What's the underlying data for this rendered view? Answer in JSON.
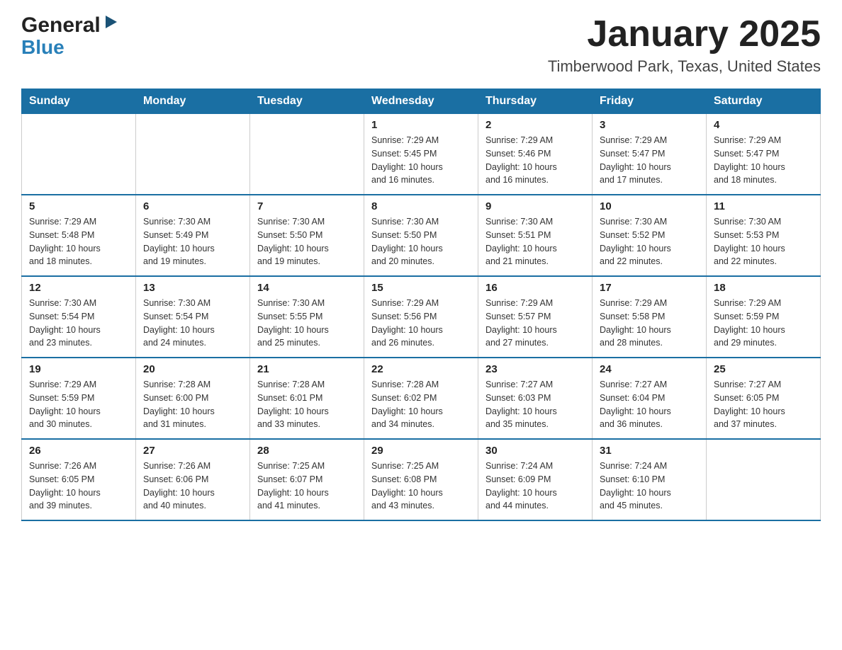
{
  "header": {
    "logo_general": "General",
    "logo_blue": "Blue",
    "month_title": "January 2025",
    "location": "Timberwood Park, Texas, United States"
  },
  "weekdays": [
    "Sunday",
    "Monday",
    "Tuesday",
    "Wednesday",
    "Thursday",
    "Friday",
    "Saturday"
  ],
  "weeks": [
    [
      {
        "day": "",
        "info": ""
      },
      {
        "day": "",
        "info": ""
      },
      {
        "day": "",
        "info": ""
      },
      {
        "day": "1",
        "info": "Sunrise: 7:29 AM\nSunset: 5:45 PM\nDaylight: 10 hours\nand 16 minutes."
      },
      {
        "day": "2",
        "info": "Sunrise: 7:29 AM\nSunset: 5:46 PM\nDaylight: 10 hours\nand 16 minutes."
      },
      {
        "day": "3",
        "info": "Sunrise: 7:29 AM\nSunset: 5:47 PM\nDaylight: 10 hours\nand 17 minutes."
      },
      {
        "day": "4",
        "info": "Sunrise: 7:29 AM\nSunset: 5:47 PM\nDaylight: 10 hours\nand 18 minutes."
      }
    ],
    [
      {
        "day": "5",
        "info": "Sunrise: 7:29 AM\nSunset: 5:48 PM\nDaylight: 10 hours\nand 18 minutes."
      },
      {
        "day": "6",
        "info": "Sunrise: 7:30 AM\nSunset: 5:49 PM\nDaylight: 10 hours\nand 19 minutes."
      },
      {
        "day": "7",
        "info": "Sunrise: 7:30 AM\nSunset: 5:50 PM\nDaylight: 10 hours\nand 19 minutes."
      },
      {
        "day": "8",
        "info": "Sunrise: 7:30 AM\nSunset: 5:50 PM\nDaylight: 10 hours\nand 20 minutes."
      },
      {
        "day": "9",
        "info": "Sunrise: 7:30 AM\nSunset: 5:51 PM\nDaylight: 10 hours\nand 21 minutes."
      },
      {
        "day": "10",
        "info": "Sunrise: 7:30 AM\nSunset: 5:52 PM\nDaylight: 10 hours\nand 22 minutes."
      },
      {
        "day": "11",
        "info": "Sunrise: 7:30 AM\nSunset: 5:53 PM\nDaylight: 10 hours\nand 22 minutes."
      }
    ],
    [
      {
        "day": "12",
        "info": "Sunrise: 7:30 AM\nSunset: 5:54 PM\nDaylight: 10 hours\nand 23 minutes."
      },
      {
        "day": "13",
        "info": "Sunrise: 7:30 AM\nSunset: 5:54 PM\nDaylight: 10 hours\nand 24 minutes."
      },
      {
        "day": "14",
        "info": "Sunrise: 7:30 AM\nSunset: 5:55 PM\nDaylight: 10 hours\nand 25 minutes."
      },
      {
        "day": "15",
        "info": "Sunrise: 7:29 AM\nSunset: 5:56 PM\nDaylight: 10 hours\nand 26 minutes."
      },
      {
        "day": "16",
        "info": "Sunrise: 7:29 AM\nSunset: 5:57 PM\nDaylight: 10 hours\nand 27 minutes."
      },
      {
        "day": "17",
        "info": "Sunrise: 7:29 AM\nSunset: 5:58 PM\nDaylight: 10 hours\nand 28 minutes."
      },
      {
        "day": "18",
        "info": "Sunrise: 7:29 AM\nSunset: 5:59 PM\nDaylight: 10 hours\nand 29 minutes."
      }
    ],
    [
      {
        "day": "19",
        "info": "Sunrise: 7:29 AM\nSunset: 5:59 PM\nDaylight: 10 hours\nand 30 minutes."
      },
      {
        "day": "20",
        "info": "Sunrise: 7:28 AM\nSunset: 6:00 PM\nDaylight: 10 hours\nand 31 minutes."
      },
      {
        "day": "21",
        "info": "Sunrise: 7:28 AM\nSunset: 6:01 PM\nDaylight: 10 hours\nand 33 minutes."
      },
      {
        "day": "22",
        "info": "Sunrise: 7:28 AM\nSunset: 6:02 PM\nDaylight: 10 hours\nand 34 minutes."
      },
      {
        "day": "23",
        "info": "Sunrise: 7:27 AM\nSunset: 6:03 PM\nDaylight: 10 hours\nand 35 minutes."
      },
      {
        "day": "24",
        "info": "Sunrise: 7:27 AM\nSunset: 6:04 PM\nDaylight: 10 hours\nand 36 minutes."
      },
      {
        "day": "25",
        "info": "Sunrise: 7:27 AM\nSunset: 6:05 PM\nDaylight: 10 hours\nand 37 minutes."
      }
    ],
    [
      {
        "day": "26",
        "info": "Sunrise: 7:26 AM\nSunset: 6:05 PM\nDaylight: 10 hours\nand 39 minutes."
      },
      {
        "day": "27",
        "info": "Sunrise: 7:26 AM\nSunset: 6:06 PM\nDaylight: 10 hours\nand 40 minutes."
      },
      {
        "day": "28",
        "info": "Sunrise: 7:25 AM\nSunset: 6:07 PM\nDaylight: 10 hours\nand 41 minutes."
      },
      {
        "day": "29",
        "info": "Sunrise: 7:25 AM\nSunset: 6:08 PM\nDaylight: 10 hours\nand 43 minutes."
      },
      {
        "day": "30",
        "info": "Sunrise: 7:24 AM\nSunset: 6:09 PM\nDaylight: 10 hours\nand 44 minutes."
      },
      {
        "day": "31",
        "info": "Sunrise: 7:24 AM\nSunset: 6:10 PM\nDaylight: 10 hours\nand 45 minutes."
      },
      {
        "day": "",
        "info": ""
      }
    ]
  ]
}
